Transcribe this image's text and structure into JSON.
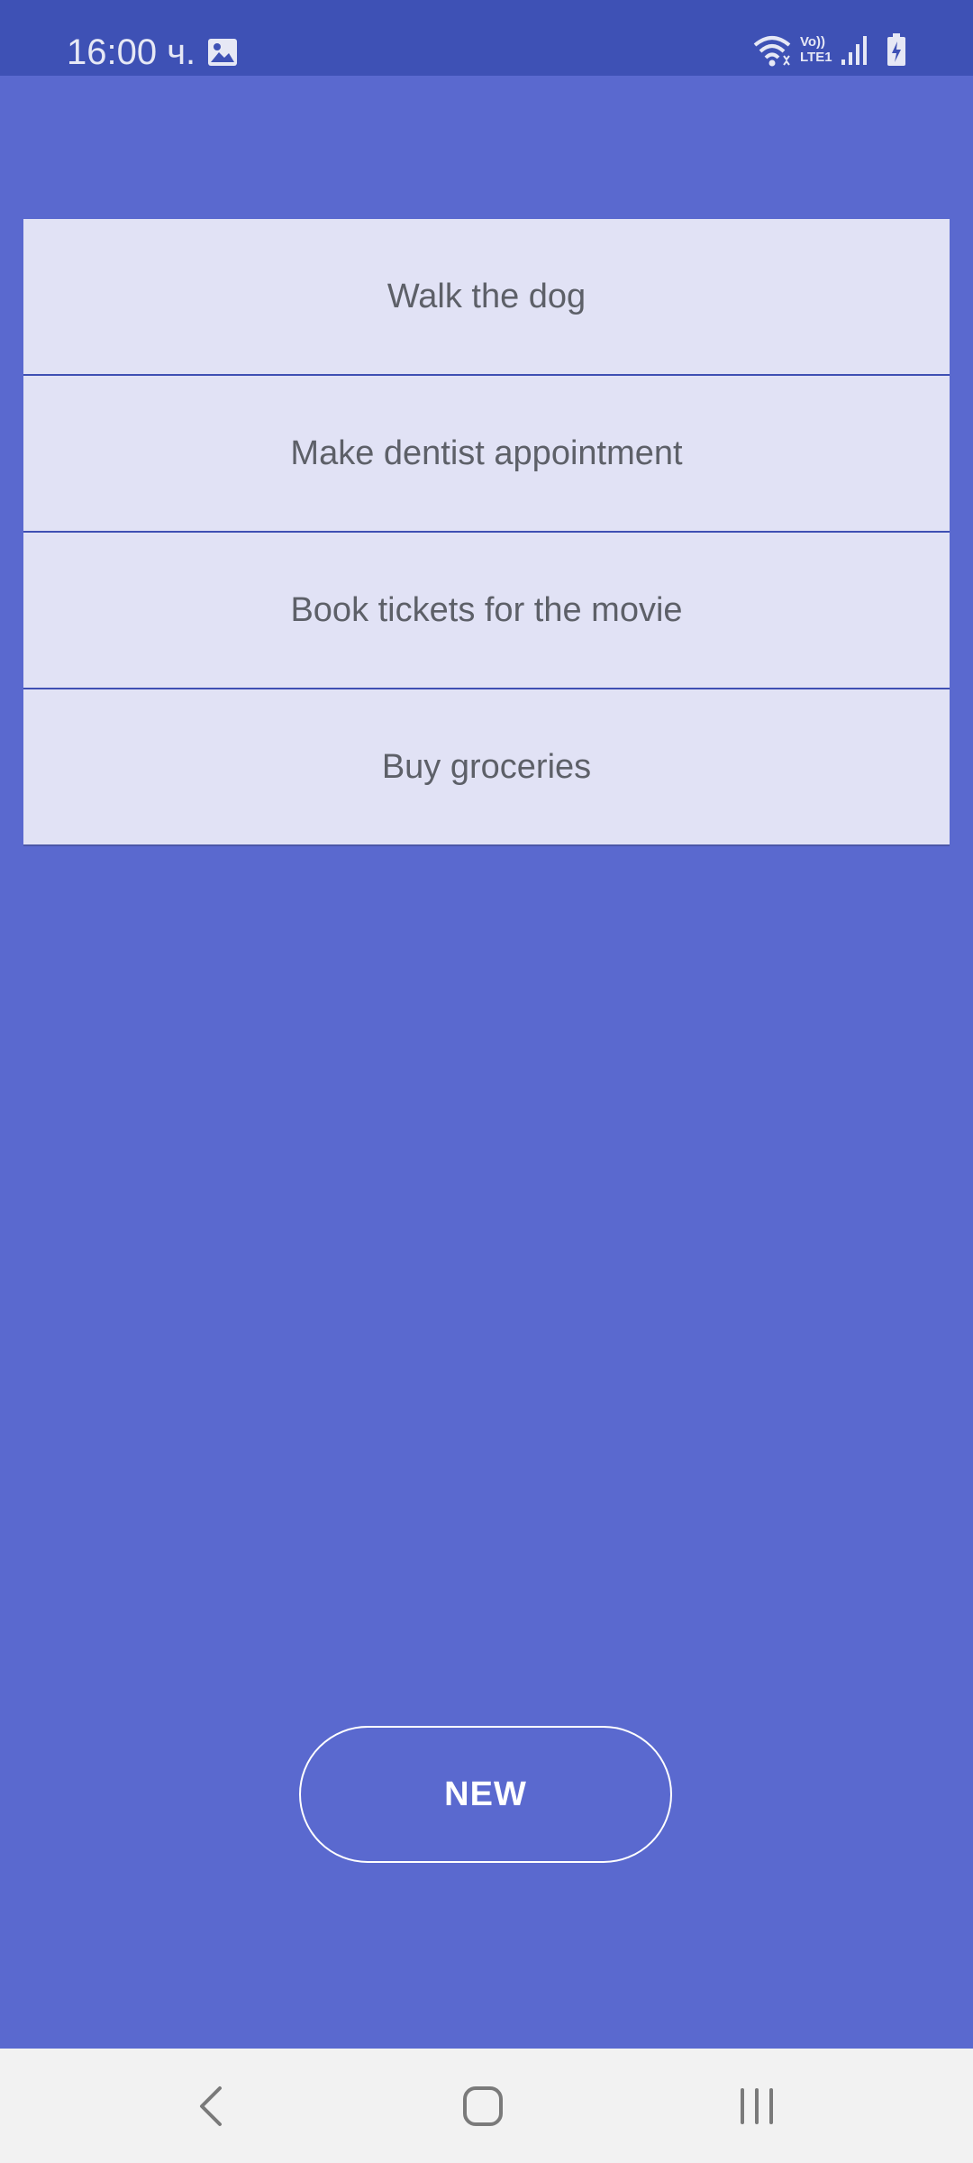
{
  "status_bar": {
    "time": "16:00 ч.",
    "network_label": "Vo))\nLTE1",
    "icons": [
      "gallery-icon",
      "wifi-icon",
      "signal-icon",
      "battery-charging-icon"
    ]
  },
  "tasks": [
    {
      "label": "Walk the dog"
    },
    {
      "label": "Make dentist appointment"
    },
    {
      "label": "Book tickets for the movie"
    },
    {
      "label": "Buy groceries"
    }
  ],
  "new_button": {
    "label": "NEW"
  },
  "nav_bar": {
    "icons": [
      "back-icon",
      "home-icon",
      "recents-icon"
    ]
  },
  "colors": {
    "background": "#5a69cf",
    "status_bar": "#3e51b5",
    "list_item": "#e1e2f5",
    "divider": "#3f4fb3",
    "nav_bar": "#f2f2f2"
  }
}
